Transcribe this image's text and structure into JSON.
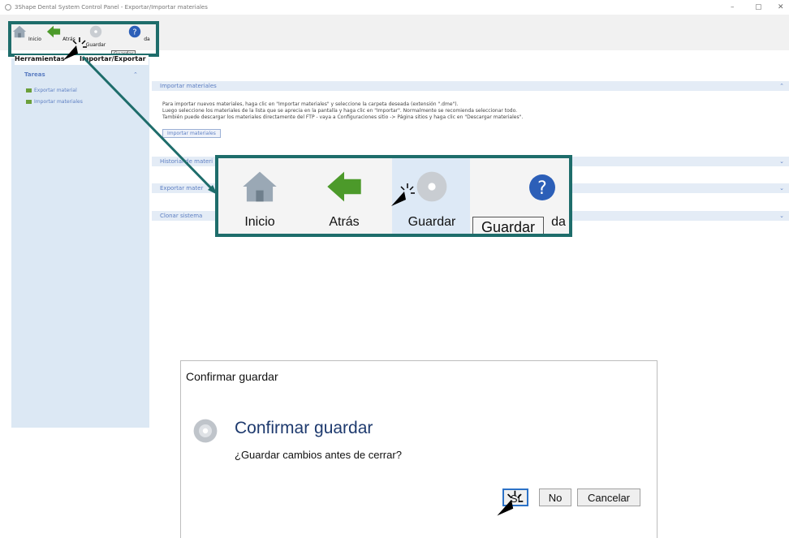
{
  "window": {
    "title": "3Shape Dental System Control Panel - Exportar/Importar materiales",
    "controls": [
      "–",
      "▢",
      "✕"
    ]
  },
  "toolbar": {
    "items": [
      {
        "label": "Inicio",
        "icon": "home-icon"
      },
      {
        "label": "Atrás",
        "icon": "back-arrow-icon"
      },
      {
        "label": "Guardar",
        "icon": "save-disc-icon"
      },
      {
        "label": "Ayuda",
        "icon": "help-icon"
      }
    ],
    "tooltip": "Guardar",
    "small_partial_help": "da"
  },
  "sidebar": {
    "header": "Herramientas - Importar/Exportar",
    "header_visible": "Herramientas",
    "header_tail": "Importar/Exportar",
    "section": "Tareas",
    "collapse_glyph": "⌃",
    "links": [
      "Exportar material",
      "Importar materiales"
    ]
  },
  "panels": [
    {
      "title": "Importar materiales",
      "chev": "⌃"
    },
    {
      "title": "Historial de materiales",
      "visible": "Historial de materi",
      "chev": "⌄"
    },
    {
      "title": "Exportar materiales",
      "visible": "Exportar mater",
      "chev": "⌄"
    },
    {
      "title": "Clonar sistema",
      "chev": "⌄"
    }
  ],
  "import_panel": {
    "text_lines": [
      "Para importar nuevos materiales, haga clic en \"Importar materiales\" y seleccione la carpeta deseada (extensión \".dme\").",
      "Luego seleccione los materiales de la lista que se aprecia en la pantalla y haga clic en \"Importar\". Normalmente se recomienda seleccionar todo.",
      "También puede descargar los materiales directamente del FTP - vaya a Configuraciones sitio -> Página sitios y haga clic en \"Descargar materiales\"."
    ],
    "button_label": "Importar materiales"
  },
  "zoom": {
    "labels": [
      "Inicio",
      "Atrás",
      "Guardar",
      "da"
    ],
    "tooltip": "Guardar"
  },
  "dialog": {
    "title": "Confirmar guardar",
    "heading": "Confirmar guardar",
    "question": "¿Guardar cambios antes de cerrar?",
    "buttons": {
      "yes": "Sí",
      "no": "No",
      "cancel": "Cancelar"
    }
  },
  "colors": {
    "accent": "#1e6d6b",
    "sidebar_bg": "#dce8f4",
    "link": "#5c7ec2"
  }
}
